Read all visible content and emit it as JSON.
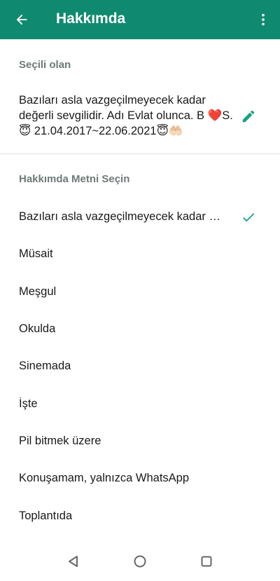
{
  "app": {
    "title": "Hakkımda"
  },
  "current": {
    "section_label": "Seçili olan",
    "text": "Bazıları asla vazgeçilmeyecek kadar değerli sevgilidir. Adı Evlat olunca. B ❤️S. 😇 21.04.2017~22.06.2021😇🤲🏻"
  },
  "options": {
    "section_label": "Hakkımda Metni Seçin",
    "items": [
      {
        "label": "Bazıları asla vazgeçilmeyecek kadar değerli sevgilidir. Adı Evlat olunca.",
        "selected": true
      },
      {
        "label": "Müsait"
      },
      {
        "label": "Meşgul"
      },
      {
        "label": "Okulda"
      },
      {
        "label": "Sinemada"
      },
      {
        "label": "İşte"
      },
      {
        "label": "Pil bitmek üzere"
      },
      {
        "label": "Konuşamam, yalnızca WhatsApp"
      },
      {
        "label": "Toplantıda"
      }
    ]
  },
  "colors": {
    "brand": "#0f8a70",
    "accent": "#16a085",
    "section_label": "#6d7a78"
  },
  "icons": [
    "arrow-back-icon",
    "more-vert-icon",
    "pencil-icon",
    "check-icon",
    "nav-back-icon",
    "nav-home-icon",
    "nav-recents-icon"
  ]
}
